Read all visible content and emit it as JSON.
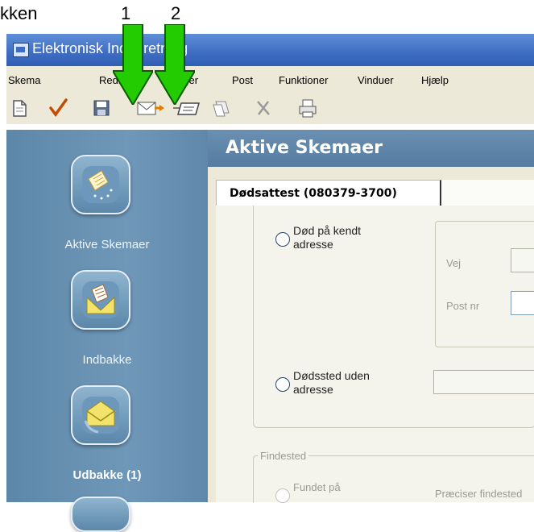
{
  "annotation": {
    "text": "kken",
    "numbers": [
      "1",
      "2"
    ]
  },
  "window": {
    "title": "Elektronisk Indberetning"
  },
  "menu": [
    "Skema",
    "Rediger",
    "Bruger",
    "Post",
    "Funktioner",
    "Vinduer",
    "Hjælp"
  ],
  "toolbar": [
    "new-icon",
    "check-icon",
    "save-icon",
    "send-icon",
    "outbox-icon",
    "copy-icon",
    "delete-icon",
    "print-icon"
  ],
  "sidebar": {
    "items": [
      {
        "label": "Aktive Skemaer",
        "icon": "active-forms-icon"
      },
      {
        "label": "Indbakke",
        "icon": "inbox-icon"
      },
      {
        "label": "Udbakke (1)",
        "icon": "outbox-icon"
      }
    ]
  },
  "main": {
    "title": "Aktive Skemaer",
    "tab": "Dødsattest (080379-3700)",
    "form": {
      "option_known_address": "Død på kendt\nadresse",
      "vej_label": "Vej",
      "post_nr_label": "Post nr",
      "option_no_address": "Dødssted uden\nadresse",
      "findested_label": "Findested",
      "fundet_paa": "Fundet på",
      "praeciser_findested": "Præciser findested"
    }
  },
  "colors": {
    "arrow": "#22cc00",
    "titlebar": "#3e6cc2",
    "sidebar": "#6a93b5",
    "main_header": "#5f86a9"
  }
}
